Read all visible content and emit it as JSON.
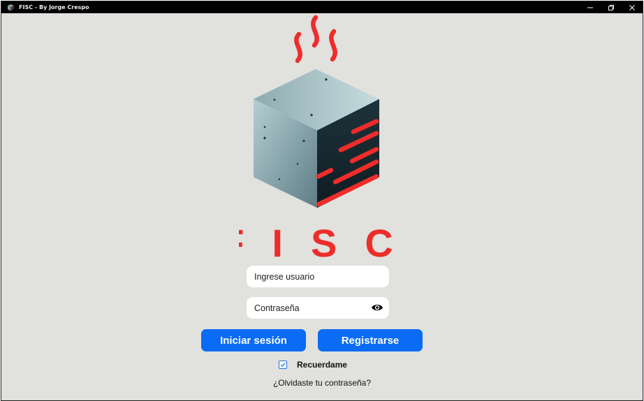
{
  "window": {
    "title": "FISC - By Jorge Crespo"
  },
  "logo": {
    "wordmark": "FISC",
    "colors": {
      "red": "#ee2d2b",
      "cube_light": "#9db8be",
      "cube_dark": "#15252c"
    }
  },
  "login": {
    "username_placeholder": "Ingrese usuario",
    "password_placeholder": "Contraseña",
    "login_label": "Iniciar sesión",
    "register_label": "Registrarse",
    "remember_label": "Recuerdame",
    "remember_checked": true,
    "forgot_label": "¿Olvidaste tu contraseña?"
  },
  "colors": {
    "background": "#e1e1de",
    "accent": "#0a6cf4",
    "titlebar": "#000000"
  }
}
